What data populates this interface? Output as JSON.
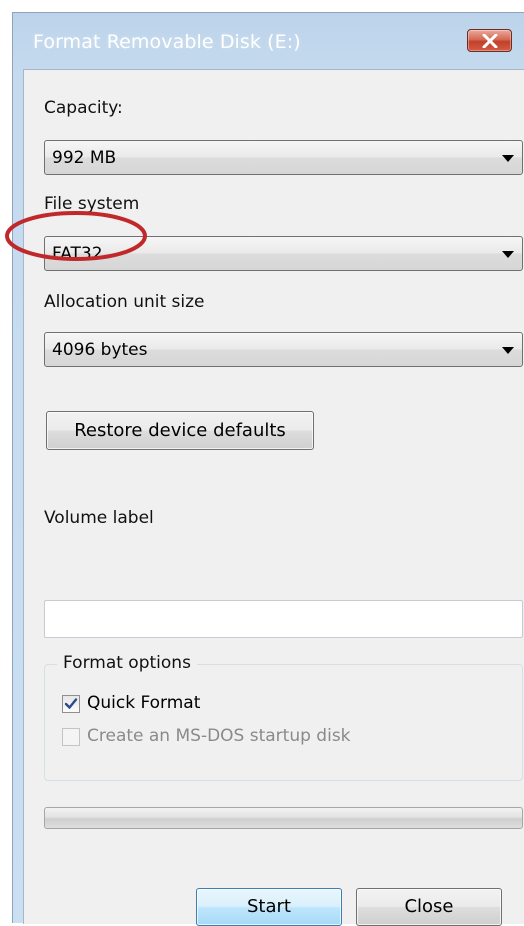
{
  "window": {
    "title": "Format Removable Disk (E:)"
  },
  "capacity": {
    "label": "Capacity:",
    "value": "992 MB"
  },
  "file_system": {
    "label": "File system",
    "value": "FAT32"
  },
  "allocation_unit": {
    "label": "Allocation unit size",
    "value": "4096 bytes"
  },
  "restore_button": {
    "label": "Restore device defaults"
  },
  "volume_label": {
    "label": "Volume label",
    "value": ""
  },
  "format_options": {
    "title": "Format options",
    "quick_format": {
      "label": "Quick Format",
      "checked": true
    },
    "ms_dos": {
      "label": "Create an MS-DOS startup disk",
      "checked": false,
      "enabled": false
    }
  },
  "progress": {
    "fraction": 0
  },
  "buttons": {
    "start": "Start",
    "close": "Close"
  },
  "colors": {
    "annotation": "#c0282a",
    "default_button_border": "#3c7fb1",
    "disabled_text": "#8a8a8a"
  },
  "icons": {
    "close": "close-x-icon",
    "dropdown": "chevron-down-icon",
    "check": "checkmark-icon"
  }
}
